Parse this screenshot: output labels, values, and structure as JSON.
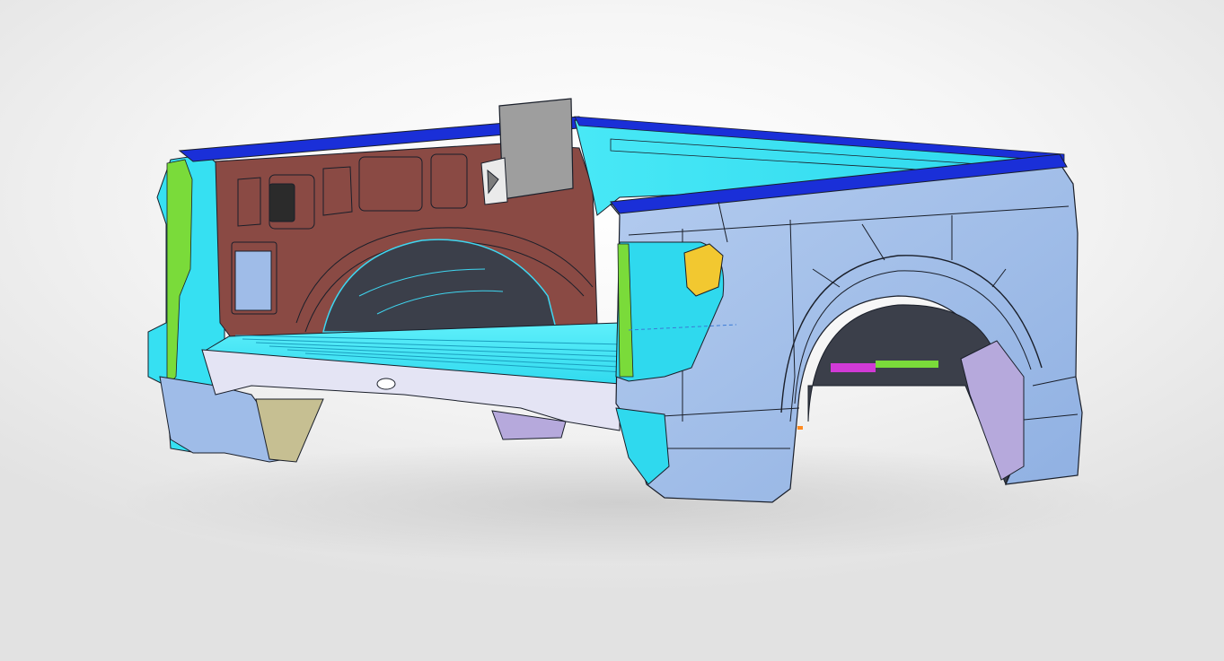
{
  "viewer": {
    "background_top": "#ffffff",
    "background_bottom": "#e2e2e2"
  },
  "model": {
    "component_colors": {
      "outer_side_panel": "#9fbce8",
      "bed_floor_and_front_wall": "#35e4f4",
      "inner_side_panel_maroon": "#8a4a44",
      "top_rail_cap": "#1a2fd8",
      "wheel_house_dark": "#3b3f4a",
      "front_lower_beam": "#e4e4f4",
      "bracket_plate": "#9e9e9e",
      "latch_yellow": "#f2c830",
      "liner_lavender": "#b6a9dc",
      "green_part": "#7adb3a",
      "magenta_part": "#d13ad6",
      "bracket_tan": "#c6bf92",
      "edge_line": "#1a1f2a"
    }
  }
}
